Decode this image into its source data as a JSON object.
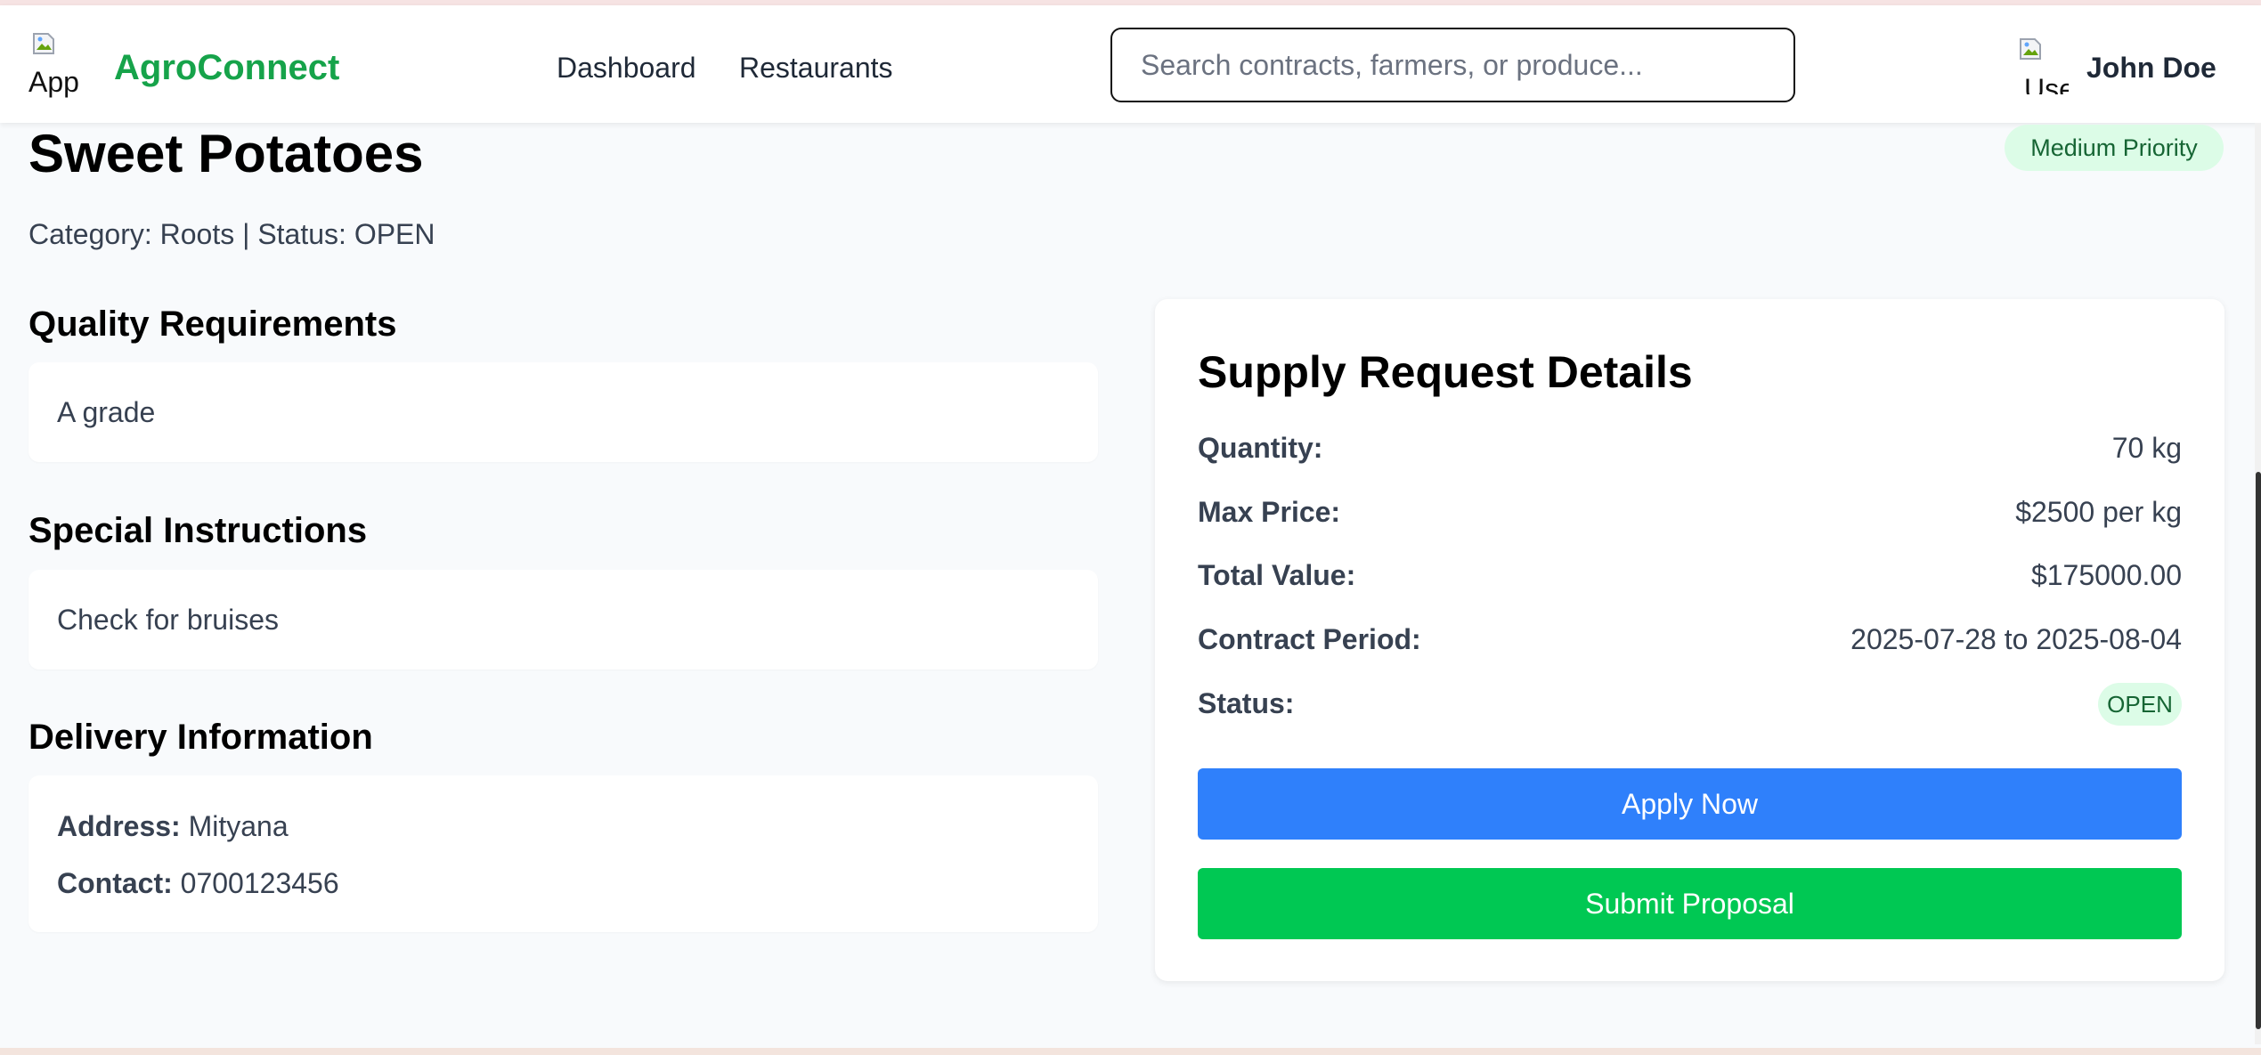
{
  "header": {
    "logo_alt": "App",
    "brand": "AgroConnect",
    "nav": [
      "Dashboard",
      "Restaurants"
    ],
    "search_placeholder": "Search contracts, farmers, or produce...",
    "avatar_alt": "Use",
    "user_name": "John Doe"
  },
  "request": {
    "title": "Sweet Potatoes",
    "priority": "Medium Priority",
    "meta": "Category: Roots | Status: OPEN"
  },
  "sections": {
    "quality_heading": "Quality Requirements",
    "quality_text": "A grade",
    "instructions_heading": "Special Instructions",
    "instructions_text": "Check for bruises",
    "delivery_heading": "Delivery Information",
    "address_label": "Address:",
    "address_value": "Mityana",
    "contact_label": "Contact:",
    "contact_value": "0700123456"
  },
  "details": {
    "title": "Supply Request Details",
    "quantity_label": "Quantity:",
    "quantity_value": "70 kg",
    "max_price_label": "Max Price:",
    "max_price_value": "$2500 per kg",
    "total_label": "Total Value:",
    "total_value": "$175000.00",
    "period_label": "Contract Period:",
    "period_value": "2025-07-28 to 2025-08-04",
    "status_label": "Status:",
    "status_value": "OPEN",
    "apply_label": "Apply Now",
    "submit_label": "Submit Proposal"
  },
  "colors": {
    "brand": "#16a34a",
    "apply_button": "#2f80fb",
    "submit_button": "#00c853",
    "badge_bg": "#dcfce7",
    "badge_text": "#166534"
  }
}
